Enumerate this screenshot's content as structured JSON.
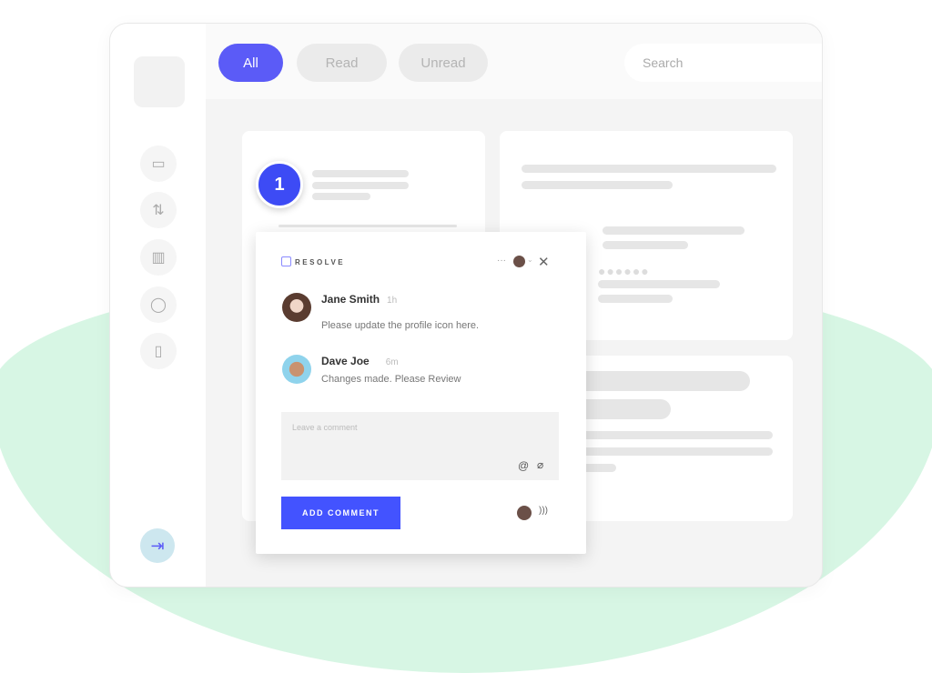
{
  "filters": [
    {
      "label": "All",
      "active": true
    },
    {
      "label": "Read"
    },
    {
      "label": "Unread"
    }
  ],
  "search": {
    "placeholder": "Search",
    "icon": "search-icon"
  },
  "sidebar": {
    "icons": [
      "wallet-icon",
      "transfer-icon",
      "chart-icon",
      "chat-icon",
      "document-icon"
    ],
    "logout_icon": "logout-icon"
  },
  "badge": {
    "number": "1"
  },
  "popup": {
    "resolve_label": "RESOLVE",
    "comments": [
      {
        "name": "Jane Smith",
        "time": "1h",
        "text": "Please update the profile icon here."
      },
      {
        "name": "Dave Joe",
        "time": "6m",
        "text": "Changes made. Please Review"
      }
    ],
    "comment_placeholder": "Leave a comment",
    "add_comment_label": "ADD COMMENT"
  },
  "colors": {
    "accent": "#4353ff",
    "blob": "#d7f6e4"
  }
}
